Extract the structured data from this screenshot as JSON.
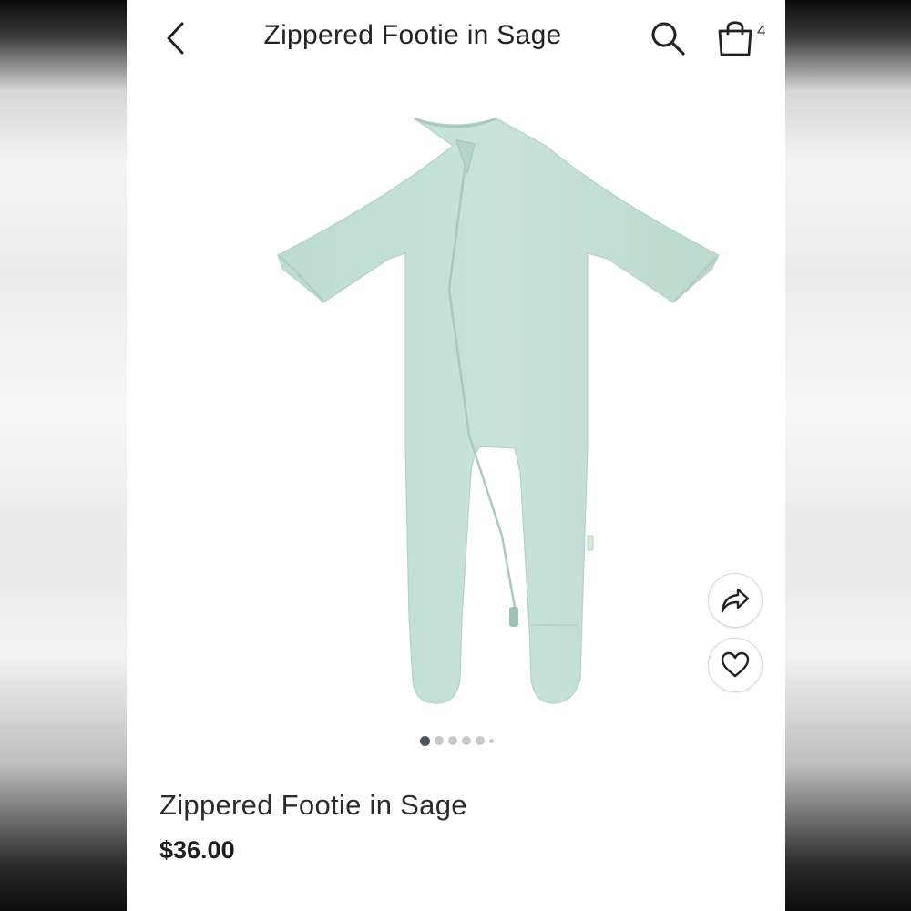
{
  "header": {
    "title": "Zippered Footie in Sage",
    "cart_count": "4",
    "icons": {
      "back": "chevron-left-icon",
      "search": "search-icon",
      "cart": "shopping-bag-icon"
    }
  },
  "product": {
    "name": "Zippered Footie in Sage",
    "price": "$36.00",
    "color": "#c6e3d8",
    "image": "sage-zippered-footie-onesie"
  },
  "carousel": {
    "total": 6,
    "active_index": 0
  },
  "actions": {
    "share_icon": "share-icon",
    "favorite_icon": "heart-icon"
  }
}
